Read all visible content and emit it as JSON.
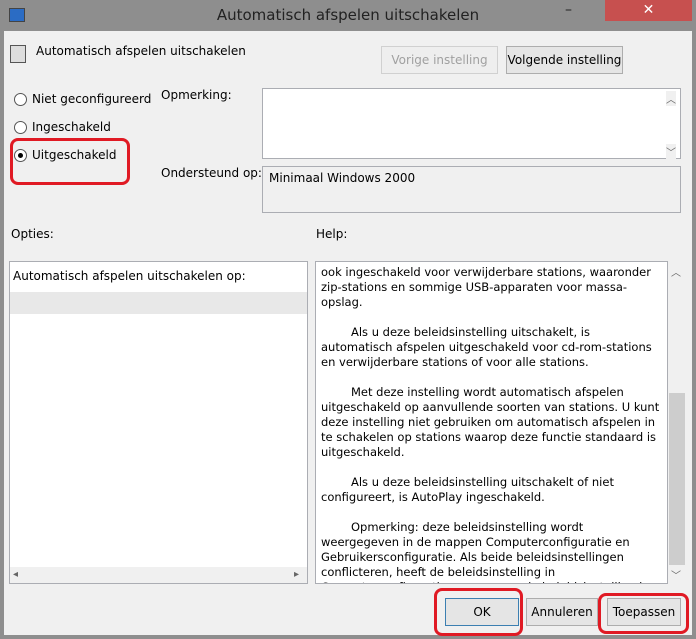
{
  "window": {
    "title": "Automatisch afspelen uitschakelen",
    "close": "✕",
    "minimize": "–",
    "maximize": "☐"
  },
  "header": {
    "policy_name": "Automatisch afspelen uitschakelen",
    "prev_label": "Vorige instelling",
    "next_label": "Volgende instelling"
  },
  "state": {
    "options": [
      {
        "label": "Niet geconfigureerd",
        "selected": false
      },
      {
        "label": "Ingeschakeld",
        "selected": false
      },
      {
        "label": "Uitgeschakeld",
        "selected": true
      }
    ]
  },
  "comment": {
    "label": "Opmerking:",
    "value": ""
  },
  "supported": {
    "label": "Ondersteund op:",
    "value": "Minimaal Windows 2000"
  },
  "options_panel": {
    "label": "Opties:",
    "item": "Automatisch afspelen uitschakelen op:"
  },
  "help_panel": {
    "label": "Help:",
    "paragraphs": [
      "ook ingeschakeld voor verwijderbare stations, waaronder zip-stations en sommige USB-apparaten voor massa-opslag.",
      "Als u deze beleidsinstelling uitschakelt, is automatisch afspelen uitgeschakeld voor cd-rom-stations en verwijderbare stations of voor alle stations.",
      "Met deze instelling wordt automatisch afspelen uitgeschakeld op aanvullende soorten van stations. U kunt deze instelling niet gebruiken om automatisch afspelen in te schakelen op stations waarop deze functie standaard is uitgeschakeld.",
      "Als u deze beleidsinstelling uitschakelt of niet configureert, is AutoPlay ingeschakeld.",
      "Opmerking: deze beleidsinstelling wordt weergegeven in de mappen Computerconfiguratie en Gebruikersconfiguratie. Als beide beleidsinstellingen conflicteren, heeft de beleidsinstelling in Computerconfiguratie voorrang op de beleidsinstelling in Gebruikersconfiguratie."
    ]
  },
  "footer": {
    "ok": "OK",
    "cancel": "Annuleren",
    "apply": "Toepassen"
  },
  "colors": {
    "annotation": "#e01a24",
    "close": "#c7504f"
  }
}
